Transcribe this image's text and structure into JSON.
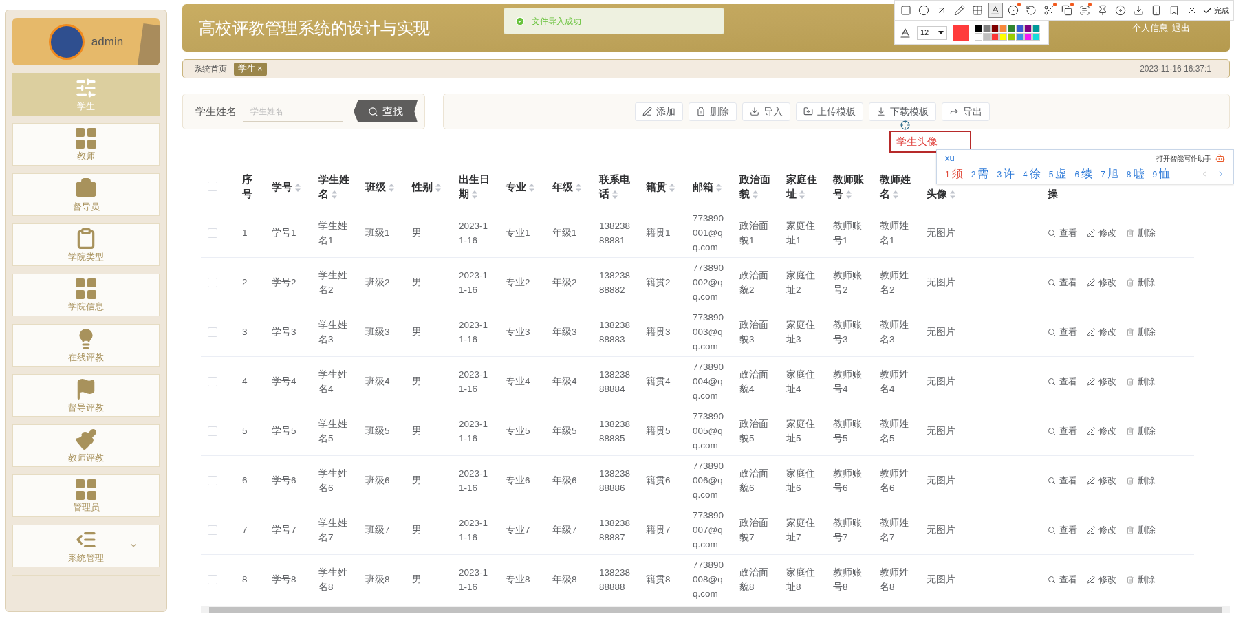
{
  "toast": {
    "message": "文件导入成功"
  },
  "capture_toolbar": {
    "tools": [
      {
        "selected": false,
        "dot": false
      },
      {
        "selected": false,
        "dot": false
      },
      {
        "selected": false,
        "dot": false
      },
      {
        "selected": false,
        "dot": false
      },
      {
        "selected": false,
        "dot": false
      },
      {
        "selected": true,
        "dot": false
      },
      {
        "selected": false,
        "dot": true
      },
      {
        "selected": false,
        "dot": false
      },
      {
        "selected": false,
        "dot": true
      },
      {
        "selected": false,
        "dot": true
      },
      {
        "selected": false,
        "dot": true
      },
      {
        "selected": false,
        "dot": false
      },
      {
        "selected": false,
        "dot": false
      },
      {
        "selected": false,
        "dot": false
      },
      {
        "selected": false,
        "dot": false
      },
      {
        "selected": false,
        "dot": false
      },
      {
        "selected": false,
        "dot": false
      }
    ],
    "done_label": "完成",
    "font_size": "12",
    "current_swatch": {
      "color": "#ff3b3b"
    },
    "palette": [
      {
        "color": "#000000"
      },
      {
        "color": "#808080"
      },
      {
        "color": "#800000"
      },
      {
        "color": "#f7883a"
      },
      {
        "color": "#308430"
      },
      {
        "color": "#385ad3"
      },
      {
        "color": "#800080"
      },
      {
        "color": "#009999"
      },
      {
        "color": "#ffffff"
      },
      {
        "color": "#c0c0c0"
      },
      {
        "color": "#fb3838"
      },
      {
        "color": "#ffff00"
      },
      {
        "color": "#99cc00"
      },
      {
        "color": "#3894e4"
      },
      {
        "color": "#f31bf3"
      },
      {
        "color": "#16dcdc"
      }
    ]
  },
  "sidebar": {
    "user": "admin",
    "items": [
      {
        "label": "学生",
        "selected": true,
        "kind": "link"
      },
      {
        "label": "教师",
        "selected": false,
        "kind": "link"
      },
      {
        "label": "督导员",
        "selected": false,
        "kind": "link"
      },
      {
        "label": "学院类型",
        "selected": false,
        "kind": "link"
      },
      {
        "label": "学院信息",
        "selected": false,
        "kind": "link"
      },
      {
        "label": "在线评教",
        "selected": false,
        "kind": "link"
      },
      {
        "label": "督导评教",
        "selected": false,
        "kind": "link"
      },
      {
        "label": "教师评教",
        "selected": false,
        "kind": "link"
      },
      {
        "label": "管理员",
        "selected": false,
        "kind": "link"
      },
      {
        "label": "系统管理",
        "selected": false,
        "kind": "group"
      }
    ]
  },
  "header": {
    "title": "高校评教管理系统的设计与实现",
    "links": [
      "个人信息",
      "退出"
    ]
  },
  "breadcrumb": {
    "home": "系统首页",
    "tags": [
      {
        "label": "学生",
        "close": "×",
        "selected": true
      }
    ],
    "datetime": "2023-11-16 16:37:1"
  },
  "search": {
    "label": "学生姓名",
    "placeholder": "学生姓名",
    "button": "查找"
  },
  "actions": [
    "添加",
    "删除",
    "导入",
    "上传模板",
    "下载模板",
    "导出"
  ],
  "annotation": {
    "text": "学生头像"
  },
  "ime": {
    "input": "xu",
    "assistant": "打开智能写作助手",
    "candidates": [
      {
        "index": "1",
        "text": "须",
        "selected": true
      },
      {
        "index": "2",
        "text": "需",
        "selected": false
      },
      {
        "index": "3",
        "text": "许",
        "selected": false
      },
      {
        "index": "4",
        "text": "徐",
        "selected": false
      },
      {
        "index": "5",
        "text": "虚",
        "selected": false
      },
      {
        "index": "6",
        "text": "续",
        "selected": false
      },
      {
        "index": "7",
        "text": "旭",
        "selected": false
      },
      {
        "index": "8",
        "text": "嘘",
        "selected": false
      },
      {
        "index": "9",
        "text": "恤",
        "selected": false
      }
    ]
  },
  "table": {
    "select_all_checked": false,
    "columns": [
      {
        "label": "序号",
        "sortable": false
      },
      {
        "label": "学号",
        "sortable": true
      },
      {
        "label": "学生姓名",
        "sortable": true
      },
      {
        "label": "班级",
        "sortable": true
      },
      {
        "label": "性别",
        "sortable": true
      },
      {
        "label": "出生日期",
        "sortable": true
      },
      {
        "label": "专业",
        "sortable": true
      },
      {
        "label": "年级",
        "sortable": true
      },
      {
        "label": "联系电话",
        "sortable": true
      },
      {
        "label": "籍贯",
        "sortable": true
      },
      {
        "label": "邮箱",
        "sortable": true
      },
      {
        "label": "政治面貌",
        "sortable": true
      },
      {
        "label": "家庭住址",
        "sortable": true
      },
      {
        "label": "教师账号",
        "sortable": true
      },
      {
        "label": "教师姓名",
        "sortable": true
      },
      {
        "label": "头像",
        "sortable": true
      },
      {
        "label": "操",
        "sortable": false
      }
    ],
    "rows": [
      {
        "checked": false,
        "cells": [
          "1",
          "学号1",
          "学生姓名1",
          "班级1",
          "男",
          "2023-11-16",
          "专业1",
          "年级1",
          "13823888881",
          "籍贯1",
          "773890001@qq.com",
          "政治面貌1",
          "家庭住址1",
          "教师账号1",
          "教师姓名1",
          "无图片"
        ],
        "actions": [
          "查看",
          "修改",
          "删除"
        ]
      },
      {
        "checked": false,
        "cells": [
          "2",
          "学号2",
          "学生姓名2",
          "班级2",
          "男",
          "2023-11-16",
          "专业2",
          "年级2",
          "13823888882",
          "籍贯2",
          "773890002@qq.com",
          "政治面貌2",
          "家庭住址2",
          "教师账号2",
          "教师姓名2",
          "无图片"
        ],
        "actions": [
          "查看",
          "修改",
          "删除"
        ]
      },
      {
        "checked": false,
        "cells": [
          "3",
          "学号3",
          "学生姓名3",
          "班级3",
          "男",
          "2023-11-16",
          "专业3",
          "年级3",
          "13823888883",
          "籍贯3",
          "773890003@qq.com",
          "政治面貌3",
          "家庭住址3",
          "教师账号3",
          "教师姓名3",
          "无图片"
        ],
        "actions": [
          "查看",
          "修改",
          "删除"
        ]
      },
      {
        "checked": false,
        "cells": [
          "4",
          "学号4",
          "学生姓名4",
          "班级4",
          "男",
          "2023-11-16",
          "专业4",
          "年级4",
          "13823888884",
          "籍贯4",
          "773890004@qq.com",
          "政治面貌4",
          "家庭住址4",
          "教师账号4",
          "教师姓名4",
          "无图片"
        ],
        "actions": [
          "查看",
          "修改",
          "删除"
        ]
      },
      {
        "checked": false,
        "cells": [
          "5",
          "学号5",
          "学生姓名5",
          "班级5",
          "男",
          "2023-11-16",
          "专业5",
          "年级5",
          "13823888885",
          "籍贯5",
          "773890005@qq.com",
          "政治面貌5",
          "家庭住址5",
          "教师账号5",
          "教师姓名5",
          "无图片"
        ],
        "actions": [
          "查看",
          "修改",
          "删除"
        ]
      },
      {
        "checked": false,
        "cells": [
          "6",
          "学号6",
          "学生姓名6",
          "班级6",
          "男",
          "2023-11-16",
          "专业6",
          "年级6",
          "13823888886",
          "籍贯6",
          "773890006@qq.com",
          "政治面貌6",
          "家庭住址6",
          "教师账号6",
          "教师姓名6",
          "无图片"
        ],
        "actions": [
          "查看",
          "修改",
          "删除"
        ]
      },
      {
        "checked": false,
        "cells": [
          "7",
          "学号7",
          "学生姓名7",
          "班级7",
          "男",
          "2023-11-16",
          "专业7",
          "年级7",
          "13823888887",
          "籍贯7",
          "773890007@qq.com",
          "政治面貌7",
          "家庭住址7",
          "教师账号7",
          "教师姓名7",
          "无图片"
        ],
        "actions": [
          "查看",
          "修改",
          "删除"
        ]
      },
      {
        "checked": false,
        "cells": [
          "8",
          "学号8",
          "学生姓名8",
          "班级8",
          "男",
          "2023-11-16",
          "专业8",
          "年级8",
          "13823888888",
          "籍贯8",
          "773890008@qq.com",
          "政治面貌8",
          "家庭住址8",
          "教师账号8",
          "教师姓名8",
          "无图片"
        ],
        "actions": [
          "查看",
          "修改",
          "删除"
        ]
      }
    ]
  }
}
